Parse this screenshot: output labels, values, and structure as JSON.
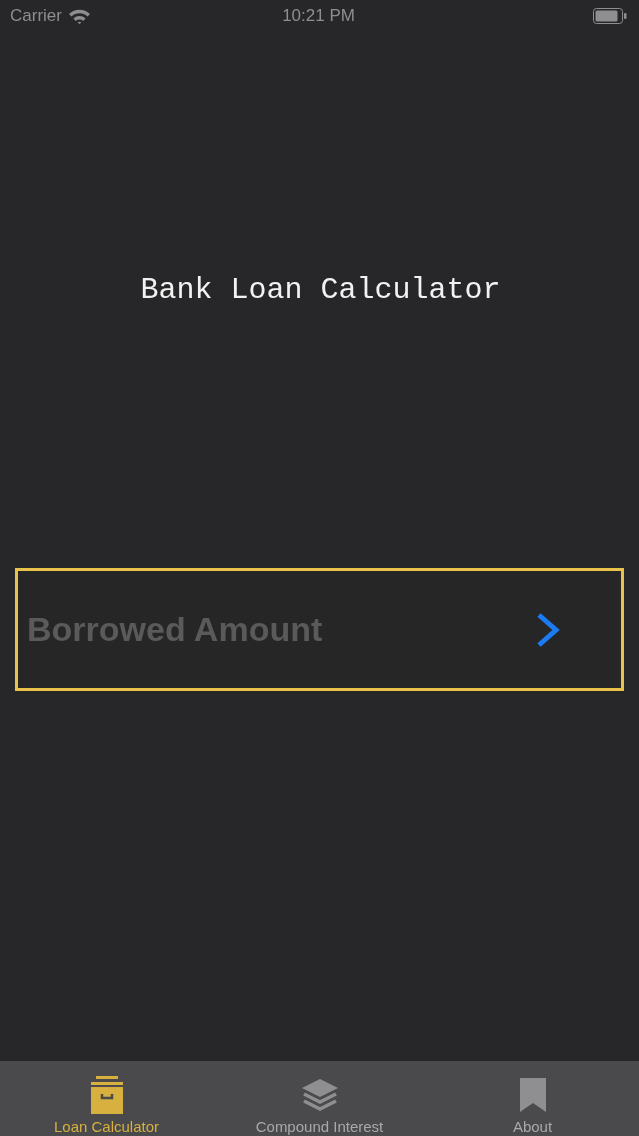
{
  "status_bar": {
    "carrier": "Carrier",
    "time": "10:21 PM"
  },
  "title": "Bank Loan Calculator",
  "amount_field": {
    "placeholder": "Borrowed Amount"
  },
  "tab_bar": {
    "tabs": [
      {
        "label": "Loan Calculator",
        "selected": true
      },
      {
        "label": "Compound Interest",
        "selected": false
      },
      {
        "label": "About",
        "selected": false
      }
    ]
  }
}
